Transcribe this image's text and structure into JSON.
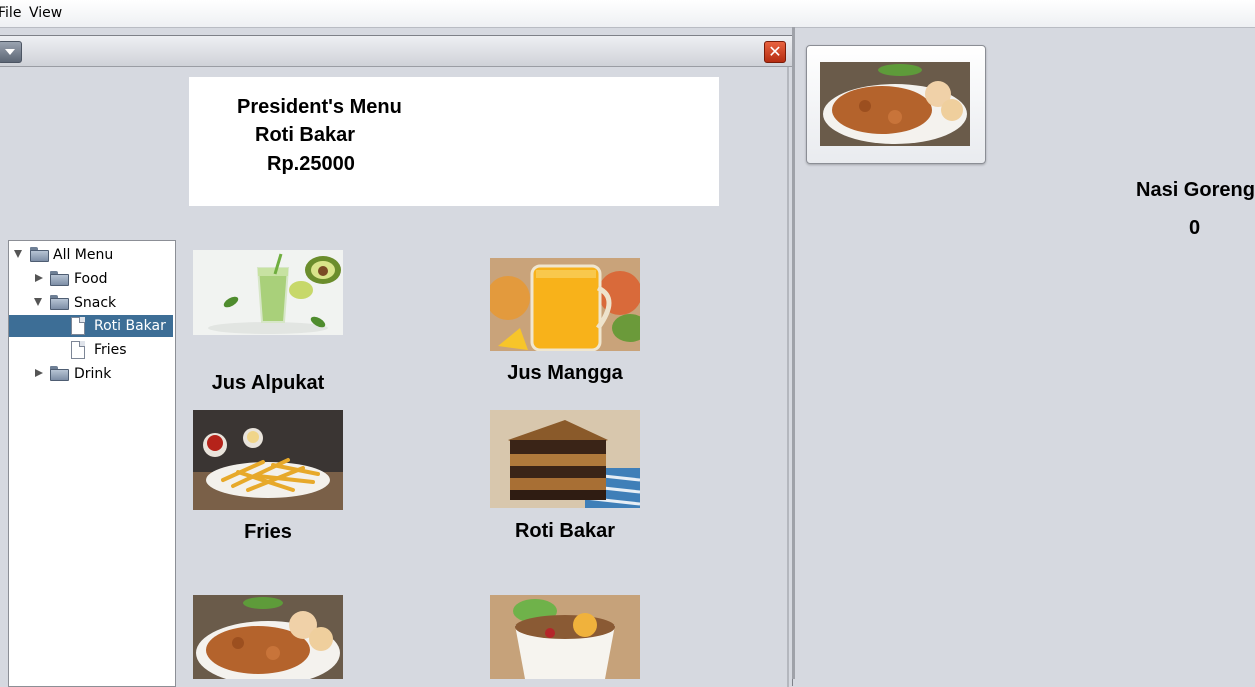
{
  "menubar": {
    "file": "File",
    "view": "View"
  },
  "frame": {
    "close_glyph": "✕"
  },
  "header": {
    "title": "President's Menu",
    "item": "Roti Bakar",
    "price": "Rp.25000"
  },
  "tree": {
    "root": "All Menu",
    "food": "Food",
    "snack": "Snack",
    "roti_bakar": "Roti Bakar",
    "fries": "Fries",
    "drink": "Drink"
  },
  "products": [
    {
      "name": "Jus Alpukat",
      "icon": "avocado-juice-photo"
    },
    {
      "name": "Jus Mangga",
      "icon": "mango-juice-photo"
    },
    {
      "name": "Fries",
      "icon": "fries-photo"
    },
    {
      "name": "Roti Bakar",
      "icon": "roti-bakar-photo"
    },
    {
      "name": "",
      "icon": "nasi-goreng-photo"
    },
    {
      "name": "",
      "icon": "rice-bowl-photo"
    }
  ],
  "detail": {
    "name": "Nasi Goreng",
    "count": "0"
  }
}
